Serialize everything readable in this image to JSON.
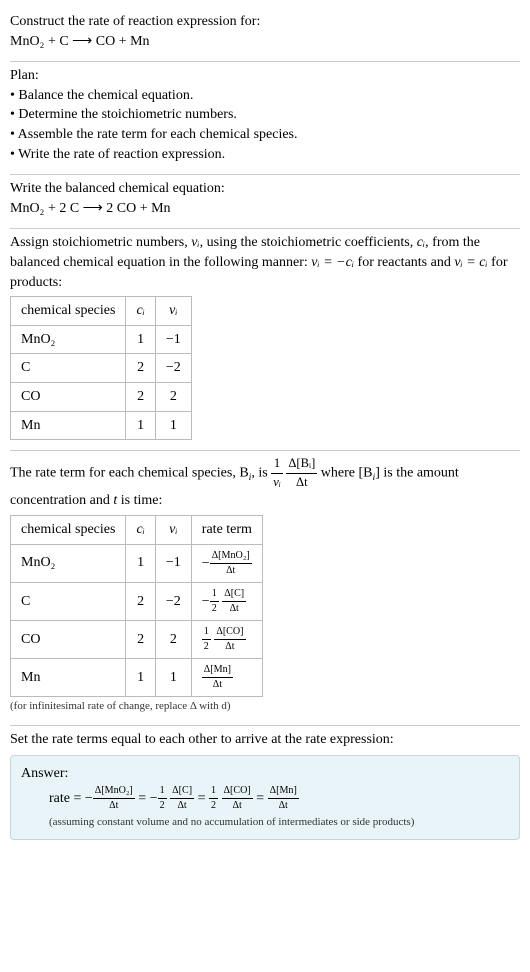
{
  "section1": {
    "title": "Construct the rate of reaction expression for:",
    "equation": "MnO₂ + C ⟶ CO + Mn"
  },
  "section2": {
    "title": "Plan:",
    "b1": "• Balance the chemical equation.",
    "b2": "• Determine the stoichiometric numbers.",
    "b3": "• Assemble the rate term for each chemical species.",
    "b4": "• Write the rate of reaction expression."
  },
  "section3": {
    "title": "Write the balanced chemical equation:",
    "equation": "MnO₂ + 2 C ⟶ 2 CO + Mn"
  },
  "section4": {
    "intro_a": "Assign stoichiometric numbers, ",
    "nu_i": "νᵢ",
    "intro_b": ", using the stoichiometric coefficients, ",
    "c_i": "cᵢ",
    "intro_c": ", from the balanced chemical equation in the following manner: ",
    "rel1": "νᵢ = −cᵢ",
    "intro_d": " for reactants and ",
    "rel2": "νᵢ = cᵢ",
    "intro_e": " for products:",
    "h1": "chemical species",
    "h2": "cᵢ",
    "h3": "νᵢ",
    "r1c1": "MnO₂",
    "r1c2": "1",
    "r1c3": "−1",
    "r2c1": "C",
    "r2c2": "2",
    "r2c3": "−2",
    "r3c1": "CO",
    "r3c2": "2",
    "r3c3": "2",
    "r4c1": "Mn",
    "r4c2": "1",
    "r4c3": "1"
  },
  "section5": {
    "intro_a": "The rate term for each chemical species, B",
    "sub_i": "i",
    "intro_b": ", is ",
    "f1n": "1",
    "f1d": "νᵢ",
    "f2n": "Δ[Bᵢ]",
    "f2d": "Δt",
    "intro_c": " where [B",
    "intro_d": "] is the amount concentration and ",
    "t": "t",
    "intro_e": " is time:",
    "h1": "chemical species",
    "h2": "cᵢ",
    "h3": "νᵢ",
    "h4": "rate term",
    "r1c1": "MnO₂",
    "r1c2": "1",
    "r1c3": "−1",
    "r1_neg": "−",
    "r1_num": "Δ[MnO₂]",
    "r1_den": "Δt",
    "r2c1": "C",
    "r2c2": "2",
    "r2c3": "−2",
    "r2_neg": "−",
    "r2_fa_n": "1",
    "r2_fa_d": "2",
    "r2_num": "Δ[C]",
    "r2_den": "Δt",
    "r3c1": "CO",
    "r3c2": "2",
    "r3c3": "2",
    "r3_fa_n": "1",
    "r3_fa_d": "2",
    "r3_num": "Δ[CO]",
    "r3_den": "Δt",
    "r4c1": "Mn",
    "r4c2": "1",
    "r4c3": "1",
    "r4_num": "Δ[Mn]",
    "r4_den": "Δt",
    "note": "(for infinitesimal rate of change, replace Δ with d)"
  },
  "section6": {
    "title": "Set the rate terms equal to each other to arrive at the rate expression:"
  },
  "answer": {
    "label": "Answer:",
    "rate": "rate = ",
    "neg1": "−",
    "t1n": "Δ[MnO₂]",
    "t1d": "Δt",
    "eq1": " = ",
    "neg2": "−",
    "t2an": "1",
    "t2ad": "2",
    "t2n": "Δ[C]",
    "t2d": "Δt",
    "eq2": " = ",
    "t3an": "1",
    "t3ad": "2",
    "t3n": "Δ[CO]",
    "t3d": "Δt",
    "eq3": " = ",
    "t4n": "Δ[Mn]",
    "t4d": "Δt",
    "note": "(assuming constant volume and no accumulation of intermediates or side products)"
  }
}
